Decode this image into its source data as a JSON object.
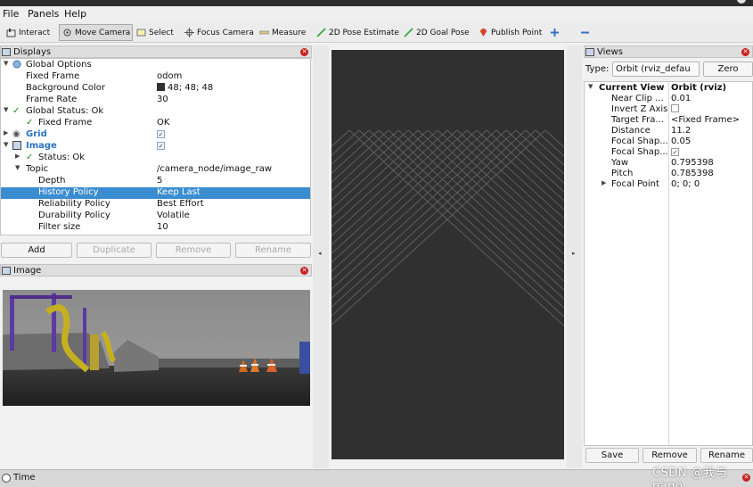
{
  "menu": {
    "file": "File",
    "panels": "Panels",
    "help": "Help"
  },
  "toolbar": {
    "interact": "Interact",
    "move_camera": "Move Camera",
    "select": "Select",
    "focus_camera": "Focus Camera",
    "measure": "Measure",
    "pose_estimate": "2D Pose Estimate",
    "goal_pose": "2D Goal Pose",
    "publish_point": "Publish Point",
    "add_icon": "plus-icon",
    "remove_icon": "minus-icon"
  },
  "displays": {
    "title": "Displays",
    "rows": [
      {
        "key": "Global Options",
        "value": ""
      },
      {
        "key": "Fixed Frame",
        "value": "odom"
      },
      {
        "key": "Background Color",
        "value": "48; 48; 48",
        "swatch": "#303030"
      },
      {
        "key": "Frame Rate",
        "value": "30"
      },
      {
        "key": "Global Status: Ok",
        "value": ""
      },
      {
        "key": "Fixed Frame",
        "value": "OK"
      },
      {
        "key": "Grid",
        "value": ""
      },
      {
        "key": "Image",
        "value": ""
      },
      {
        "key": "Status: Ok",
        "value": ""
      },
      {
        "key": "Topic",
        "value": "/camera_node/image_raw"
      },
      {
        "key": "Depth",
        "value": "5"
      },
      {
        "key": "History Policy",
        "value": "Keep Last"
      },
      {
        "key": "Reliability Policy",
        "value": "Best Effort"
      },
      {
        "key": "Durability Policy",
        "value": "Volatile"
      },
      {
        "key": "Filter size",
        "value": "10"
      }
    ],
    "buttons": {
      "add": "Add",
      "duplicate": "Duplicate",
      "remove": "Remove",
      "rename": "Rename"
    }
  },
  "image_panel": {
    "title": "Image"
  },
  "views": {
    "title": "Views",
    "type_label": "Type:",
    "type_value": "Orbit (rviz_defau",
    "zero": "Zero",
    "header_key": "Current View",
    "header_value": "Orbit (rviz)",
    "rows": [
      {
        "key": "Near Clip ...",
        "value": "0.01"
      },
      {
        "key": "Invert Z Axis",
        "value": ""
      },
      {
        "key": "Target Fra...",
        "value": "<Fixed Frame>"
      },
      {
        "key": "Distance",
        "value": "11.2"
      },
      {
        "key": "Focal Shap...",
        "value": "0.05"
      },
      {
        "key": "Focal Shap...",
        "value": ""
      },
      {
        "key": "Yaw",
        "value": "0.795398"
      },
      {
        "key": "Pitch",
        "value": "0.785398"
      },
      {
        "key": "Focal Point",
        "value": "0; 0; 0"
      }
    ],
    "buttons": {
      "save": "Save",
      "remove": "Remove",
      "rename": "Rename"
    }
  },
  "time_panel": {
    "title": "Time"
  },
  "watermark": "CSDN @我与nano",
  "colors": {
    "selection": "#3b8dd1",
    "viewport_bg": "#303030",
    "grid": "#5e5e5e",
    "status_ok": "#1a8a1a",
    "link_blue": "#2a72c4"
  }
}
